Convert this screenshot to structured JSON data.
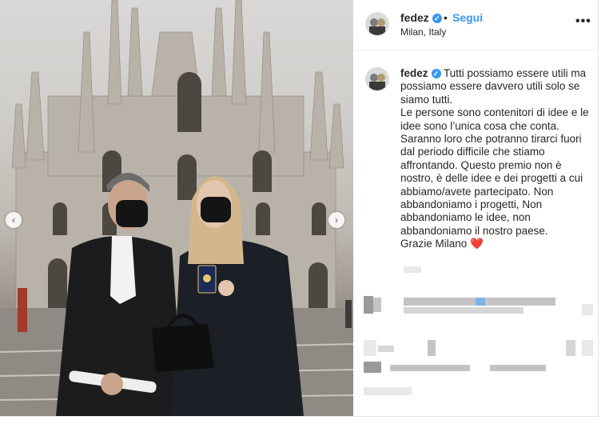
{
  "post": {
    "username": "fedez",
    "follow_label": "Segui",
    "location": "Milan, Italy",
    "more_icon": "more-options-icon",
    "caption_paragraphs": [
      "Tutti possiamo essere utili ma possiamo essere davvero utili solo se siamo tutti.",
      "Le persone sono contenitori di idee e le idee sono l’unica cosa che conta. Saranno loro che potranno tirarci fuori dal periodo difficile che stiamo affrontando. Questo premio non è nostro, è delle idee e dei progetti a cui abbiamo/avete partecipato. Non abbandoniamo i progetti, Non abbandoniamo le idee, non abbandoniamo il nostro paese.",
      "Grazie Milano"
    ],
    "heart_glyph": "❤️"
  },
  "colors": {
    "link_blue": "#3897f0",
    "text": "#262626",
    "heart": "#e0245e"
  }
}
